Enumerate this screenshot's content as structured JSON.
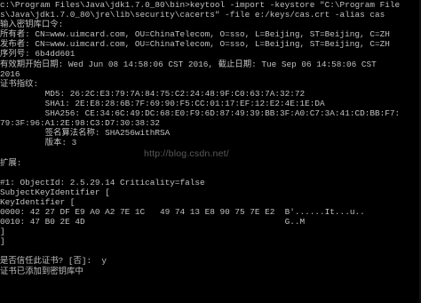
{
  "console": {
    "lines": [
      "c:\\Program Files\\Java\\jdk1.7.0_80\\bin>keytool -import -keystore \"C:\\Program File",
      "s\\Java\\jdk1.7.0_80\\jre\\lib\\security\\cacerts\" -file e:/keys/cas.crt -alias cas",
      "输入密钥库口令:",
      "所有者: CN=www.uimcard.com, OU=ChinaTelecom, O=sso, L=Beijing, ST=Beijing, C=ZH",
      "发布者: CN=www.uimcard.com, OU=ChinaTelecom, O=sso, L=Beijing, ST=Beijing, C=ZH",
      "序列号: 6b4dd601",
      "有效期开始日期: Wed Jun 08 14:58:06 CST 2016, 截止日期: Tue Sep 06 14:58:06 CST",
      "2016",
      "证书指纹:",
      "         MD5: 26:2C:E3:79:7A:84:75:C2:24:48:9F:C0:63:7A:32:72",
      "         SHA1: 2E:E8:28:6B:7F:69:90:F5:CC:01:17:EF:12:E2:4E:1E:DA",
      "         SHA256: CE:34:6C:49:DC:68:E0:F9:6D:87:49:39:BB:3F:A0:C7:3A:41:CD:BB:F7:",
      "79:3F:96:A1:2E:98:C3:D7:30:38:32",
      "         签名算法名称: SHA256withRSA",
      "         版本: 3",
      "",
      "扩展:",
      "",
      "#1: ObjectId: 2.5.29.14 Criticality=false",
      "SubjectKeyIdentifier [",
      "KeyIdentifier [",
      "0000: 42 27 DF E9 A0 A2 7E 1C   49 74 13 E8 90 75 7E E2  B'......It...u..",
      "0010: 47 B0 2E 4D                                        G..M",
      "]",
      "]",
      "",
      "是否信任此证书? [否]:  y",
      "证书已添加到密钥库中"
    ],
    "watermark": "http://blog.csdn.net/"
  }
}
